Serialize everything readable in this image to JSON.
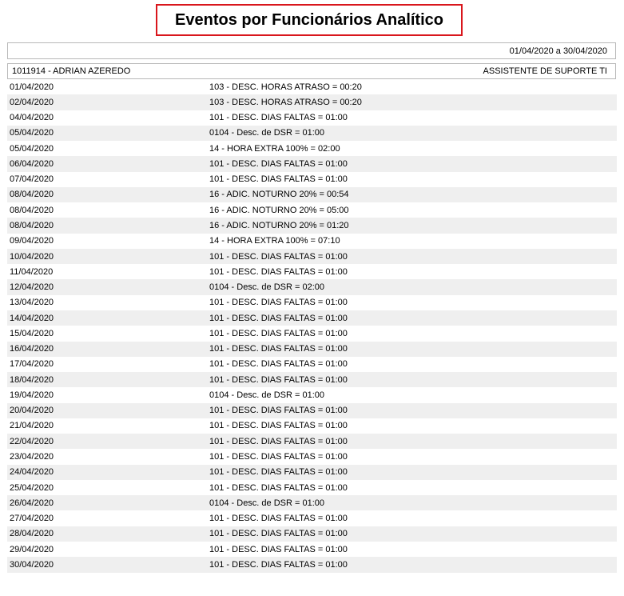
{
  "report": {
    "title": "Eventos por Funcionários Analítico",
    "period": "01/04/2020 a 30/04/2020"
  },
  "employee": {
    "id_name": "1011914 - ADRIAN AZEREDO",
    "role": "ASSISTENTE DE SUPORTE TI"
  },
  "rows": [
    {
      "date": "01/04/2020",
      "event": "103 - DESC. HORAS ATRASO = 00:20"
    },
    {
      "date": "02/04/2020",
      "event": "103 - DESC. HORAS ATRASO = 00:20"
    },
    {
      "date": "04/04/2020",
      "event": "101 - DESC. DIAS FALTAS = 01:00"
    },
    {
      "date": "05/04/2020",
      "event": "0104 - Desc. de DSR = 01:00"
    },
    {
      "date": "05/04/2020",
      "event": "14 - HORA EXTRA 100% = 02:00"
    },
    {
      "date": "06/04/2020",
      "event": "101 - DESC. DIAS FALTAS = 01:00"
    },
    {
      "date": "07/04/2020",
      "event": "101 - DESC. DIAS FALTAS = 01:00"
    },
    {
      "date": "08/04/2020",
      "event": "16 - ADIC. NOTURNO 20% = 00:54"
    },
    {
      "date": "08/04/2020",
      "event": "16 - ADIC. NOTURNO 20% = 05:00"
    },
    {
      "date": "08/04/2020",
      "event": "16 - ADIC. NOTURNO 20% = 01:20"
    },
    {
      "date": "09/04/2020",
      "event": "14 - HORA EXTRA 100% = 07:10"
    },
    {
      "date": "10/04/2020",
      "event": "101 - DESC. DIAS FALTAS = 01:00"
    },
    {
      "date": "11/04/2020",
      "event": "101 - DESC. DIAS FALTAS = 01:00"
    },
    {
      "date": "12/04/2020",
      "event": "0104 - Desc. de DSR = 02:00"
    },
    {
      "date": "13/04/2020",
      "event": "101 - DESC. DIAS FALTAS = 01:00"
    },
    {
      "date": "14/04/2020",
      "event": "101 - DESC. DIAS FALTAS = 01:00"
    },
    {
      "date": "15/04/2020",
      "event": "101 - DESC. DIAS FALTAS = 01:00"
    },
    {
      "date": "16/04/2020",
      "event": "101 - DESC. DIAS FALTAS = 01:00"
    },
    {
      "date": "17/04/2020",
      "event": "101 - DESC. DIAS FALTAS = 01:00"
    },
    {
      "date": "18/04/2020",
      "event": "101 - DESC. DIAS FALTAS = 01:00"
    },
    {
      "date": "19/04/2020",
      "event": "0104 - Desc. de DSR = 01:00"
    },
    {
      "date": "20/04/2020",
      "event": "101 - DESC. DIAS FALTAS = 01:00"
    },
    {
      "date": "21/04/2020",
      "event": "101 - DESC. DIAS FALTAS = 01:00"
    },
    {
      "date": "22/04/2020",
      "event": "101 - DESC. DIAS FALTAS = 01:00"
    },
    {
      "date": "23/04/2020",
      "event": "101 - DESC. DIAS FALTAS = 01:00"
    },
    {
      "date": "24/04/2020",
      "event": "101 - DESC. DIAS FALTAS = 01:00"
    },
    {
      "date": "25/04/2020",
      "event": "101 - DESC. DIAS FALTAS = 01:00"
    },
    {
      "date": "26/04/2020",
      "event": "0104 - Desc. de DSR = 01:00"
    },
    {
      "date": "27/04/2020",
      "event": "101 - DESC. DIAS FALTAS = 01:00"
    },
    {
      "date": "28/04/2020",
      "event": "101 - DESC. DIAS FALTAS = 01:00"
    },
    {
      "date": "29/04/2020",
      "event": "101 - DESC. DIAS FALTAS = 01:00"
    },
    {
      "date": "30/04/2020",
      "event": "101 - DESC. DIAS FALTAS = 01:00"
    }
  ]
}
